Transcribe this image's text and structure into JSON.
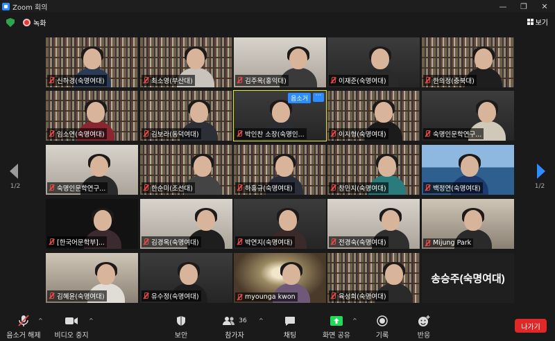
{
  "window": {
    "title": "Zoom 회의"
  },
  "topbar": {
    "recording_label": "녹화",
    "view_label": "보기"
  },
  "speaker_tile": {
    "badge": "음소거",
    "more": "···"
  },
  "tiles": [
    {
      "name": "신하경(숙명여대)"
    },
    {
      "name": "최소영(부산대)"
    },
    {
      "name": "김주옥(홍익대)"
    },
    {
      "name": "이재준(숙명여대)"
    },
    {
      "name": "한의정(충북대)"
    },
    {
      "name": "임소연(숙명여대)"
    },
    {
      "name": "김보라(동덕여대)"
    },
    {
      "name": "박인찬 소장(숙명인..."
    },
    {
      "name": "이지형(숙명여대)"
    },
    {
      "name": "숙명인문학연구..."
    },
    {
      "name": "숙명인문학연구..."
    },
    {
      "name": "한순미(조선대)"
    },
    {
      "name": "하홍규(숙명여대)"
    },
    {
      "name": "창민지(숙명여대)"
    },
    {
      "name": "백정연(숙명여대)"
    },
    {
      "name": "[한국어문학부]..."
    },
    {
      "name": "김경옥(숙명여대)"
    },
    {
      "name": "박연지(숙명여대)"
    },
    {
      "name": "전경숙(숙명여대)"
    },
    {
      "name": "Mijung Park"
    },
    {
      "name": "김혜윤(숙명여대)"
    },
    {
      "name": "유수정(숙명여대)"
    },
    {
      "name": "myounga kwon"
    },
    {
      "name": "육성희(숙명여대)"
    },
    {
      "name": "송승주(숙명여대)"
    }
  ],
  "pager": {
    "left": "1/2",
    "right": "1/2"
  },
  "toolbar": {
    "unmute": "음소거 해제",
    "stop_video": "비디오 중지",
    "security": "보안",
    "participants": "참가자",
    "participants_count": "36",
    "chat": "채팅",
    "share": "화면 공유",
    "record": "기록",
    "reactions": "반응",
    "leave": "나가기"
  },
  "colors": {
    "accent": "#2d8cff",
    "speaking": "#e3ef3a",
    "share": "#23d959",
    "leave": "#e02828",
    "mute": "#e24a4a"
  }
}
